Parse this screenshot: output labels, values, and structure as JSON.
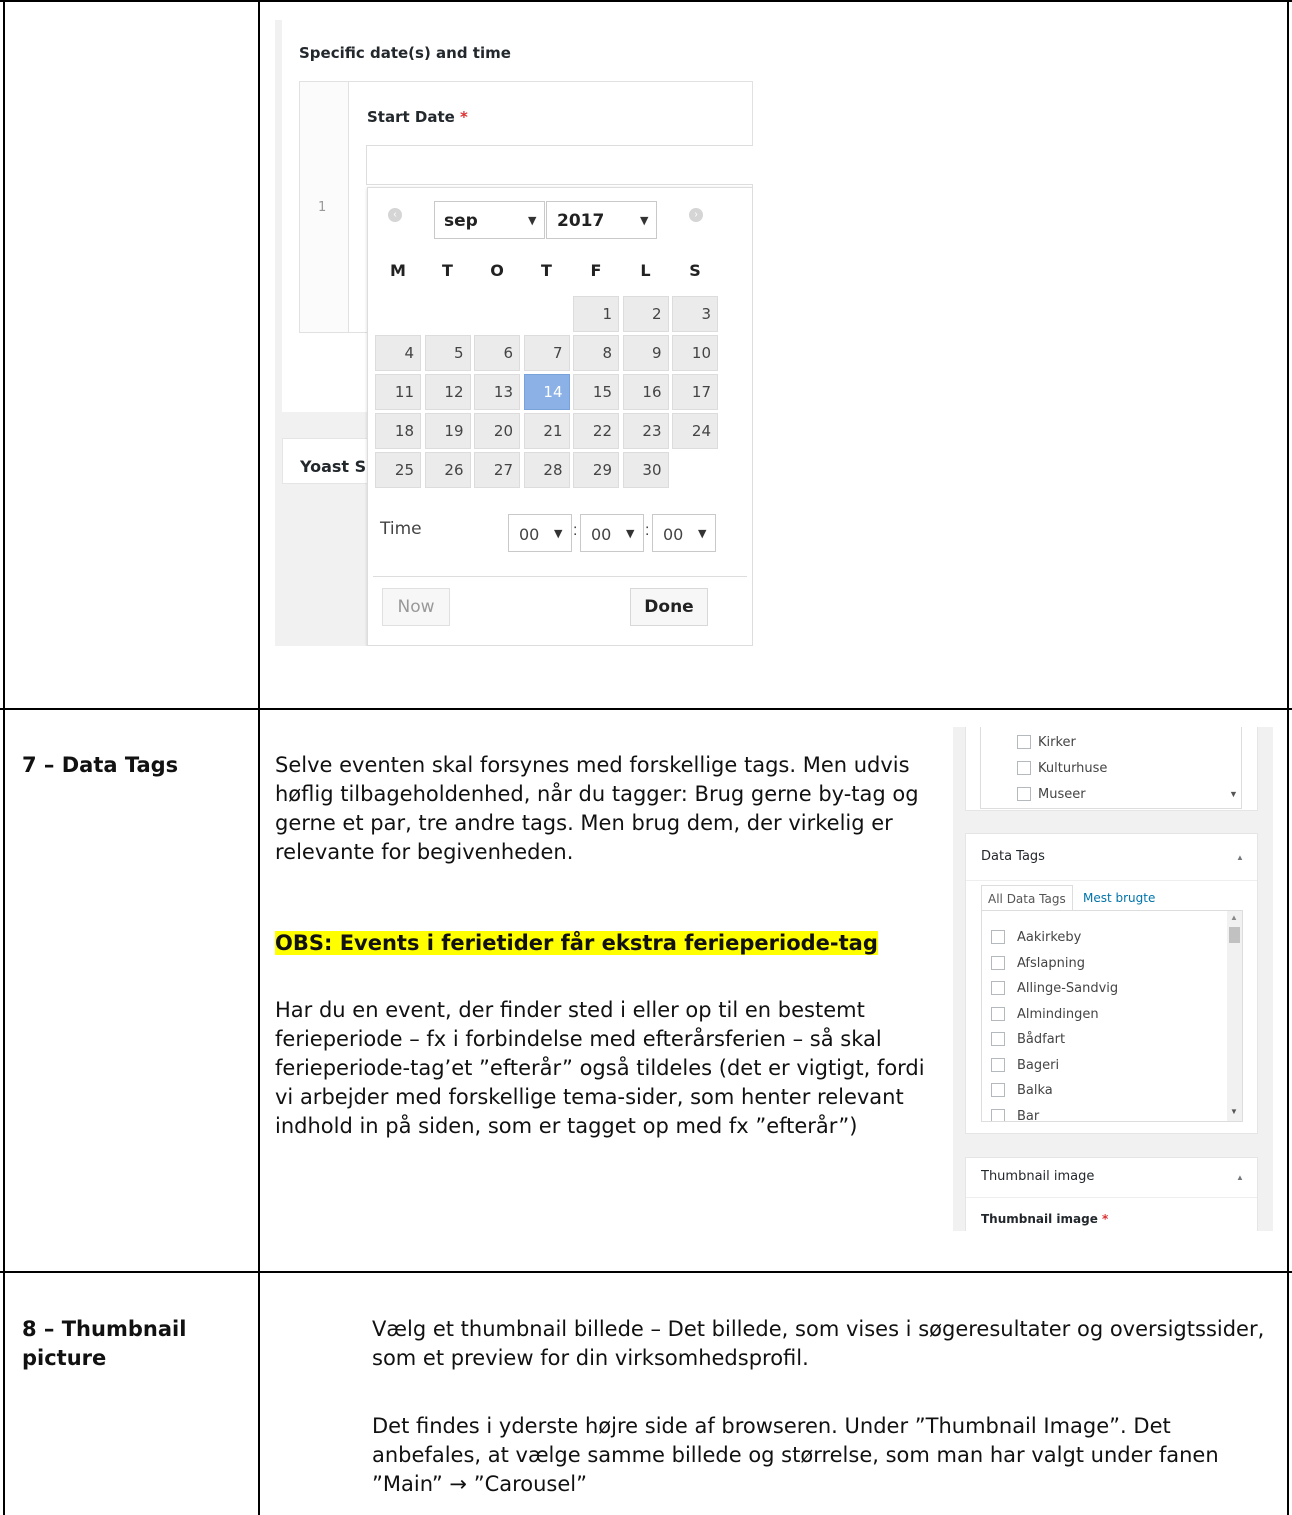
{
  "datetime_widget": {
    "section_title": "Specific date(s) and time",
    "row_number": "1",
    "start_date_label": "Start Date",
    "required_mark": "*",
    "month": "sep",
    "year": "2017",
    "weekdays": [
      "M",
      "T",
      "O",
      "T",
      "F",
      "L",
      "S"
    ],
    "weeks": [
      [
        "",
        "",
        "",
        "",
        "1",
        "2",
        "3"
      ],
      [
        "4",
        "5",
        "6",
        "7",
        "8",
        "9",
        "10"
      ],
      [
        "11",
        "12",
        "13",
        "14",
        "15",
        "16",
        "17"
      ],
      [
        "18",
        "19",
        "20",
        "21",
        "22",
        "23",
        "24"
      ],
      [
        "25",
        "26",
        "27",
        "28",
        "29",
        "30",
        ""
      ]
    ],
    "selected_day": "14",
    "time_label": "Time",
    "hour": "00",
    "minute": "00",
    "second": "00",
    "time_separator": ":",
    "now_button": "Now",
    "done_button": "Done",
    "yoast_label": "Yoast S"
  },
  "row7": {
    "label": "7 – Data Tags",
    "para1": "Selve eventen skal forsynes med forskellige tags. Men udvis høflig tilbageholdenhed, når du tagger: Brug gerne by-tag og gerne et par, tre andre tags. Men brug dem, der virkelig er relevante for begivenheden.",
    "highlight": "OBS: Events i ferietider får ekstra ferieperiode-tag",
    "para2": "Har du en event, der finder sted i eller op til en bestemt ferieperiode – fx i forbindelse med efterårsferien – så skal ferieperiode-tag’et ”efterår” også tildeles (det er vigtigt, fordi vi arbejder med forskellige tema-sider, som henter relevant indhold in på siden, som er tagget op med fx ”efterår”)"
  },
  "sidebar": {
    "category_items": [
      "Kirker",
      "Kulturhuse",
      "Museer"
    ],
    "data_tags_title": "Data Tags",
    "tab_all": "All Data Tags",
    "tab_popular": "Mest brugte",
    "tags": [
      "Aakirkeby",
      "Afslapning",
      "Allinge-Sandvig",
      "Almindingen",
      "Bådfart",
      "Bageri",
      "Balka",
      "Bar"
    ],
    "thumbnail_title": "Thumbnail image",
    "thumbnail_field_label": "Thumbnail image",
    "required_mark": "*",
    "collapse_symbol": "▲"
  },
  "row8": {
    "label": "8 – Thumbnail picture",
    "para1": "Vælg et thumbnail billede – Det billede, som vises i søgeresultater og oversigtssider, som et preview for din virksomhedsprofil.",
    "para2": "Det findes i yderste højre side af browseren. Under ”Thumbnail Image”. Det anbefales, at vælge samme billede og størrelse, som man har valgt under fanen ”Main” → ”Carousel”"
  },
  "colors": {
    "highlight": "#ffff00",
    "selected_day": "#8cb1e6",
    "link": "#0073aa",
    "required": "#dc3232"
  }
}
